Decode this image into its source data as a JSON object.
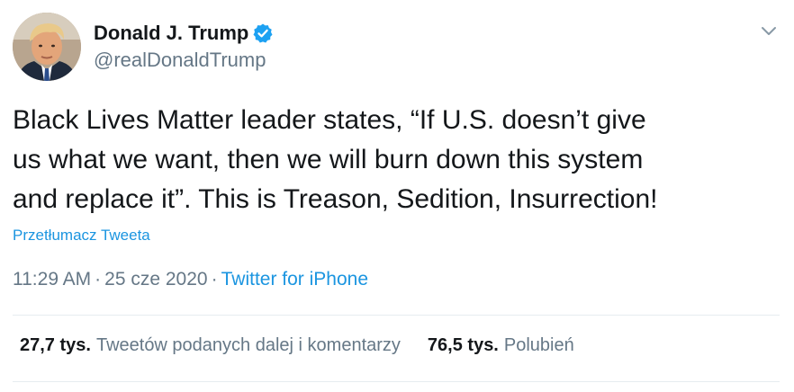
{
  "tweet": {
    "author": {
      "display_name": "Donald J. Trump",
      "handle": "@realDonaldTrump",
      "verified_icon": "verified-badge-icon",
      "avatar_icon": "avatar"
    },
    "menu_icon": "chevron-down-icon",
    "text_lines": [
      "Black Lives Matter leader states, “If U.S. doesn’t give",
      "us what we want, then we will burn down this system",
      "and replace it”. This is Treason, Sedition, Insurrection!"
    ],
    "translate_label": "Przetłumacz Tweeta",
    "time": "11:29 AM",
    "separator": "·",
    "date": "25 cze 2020",
    "source": "Twitter for iPhone",
    "stats": {
      "retweets_count": "27,7 tys.",
      "retweets_label": "Tweetów podanych dalej i komentarzy",
      "likes_count": "76,5 tys.",
      "likes_label": "Polubień"
    },
    "colors": {
      "accent": "#1b95e0",
      "verified": "#1da1f2",
      "text": "#14171a",
      "muted": "#657786",
      "divider": "#e6ecf0"
    }
  }
}
